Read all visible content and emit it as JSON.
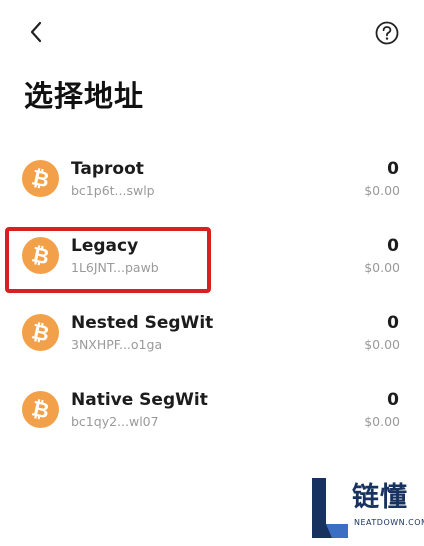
{
  "page_title": "选择地址",
  "addresses": [
    {
      "name": "Taproot",
      "address": "bc1p6t...swlp",
      "balance": "0",
      "fiat": "$0.00"
    },
    {
      "name": "Legacy",
      "address": "1L6JNT...pawb",
      "balance": "0",
      "fiat": "$0.00"
    },
    {
      "name": "Nested SegWit",
      "address": "3NXHPF...o1ga",
      "balance": "0",
      "fiat": "$0.00"
    },
    {
      "name": "Native SegWit",
      "address": "bc1qy2...wl07",
      "balance": "0",
      "fiat": "$0.00"
    }
  ],
  "icons": {
    "back": "chevron-left-icon",
    "help": "question-circle-icon",
    "coin": "bitcoin-icon"
  },
  "colors": {
    "bitcoin": "#f2a14a",
    "highlight": "#d92020",
    "watermark": "#17325e"
  },
  "watermark": {
    "text": "链懂",
    "sub": "NEATDOWN.COM"
  }
}
